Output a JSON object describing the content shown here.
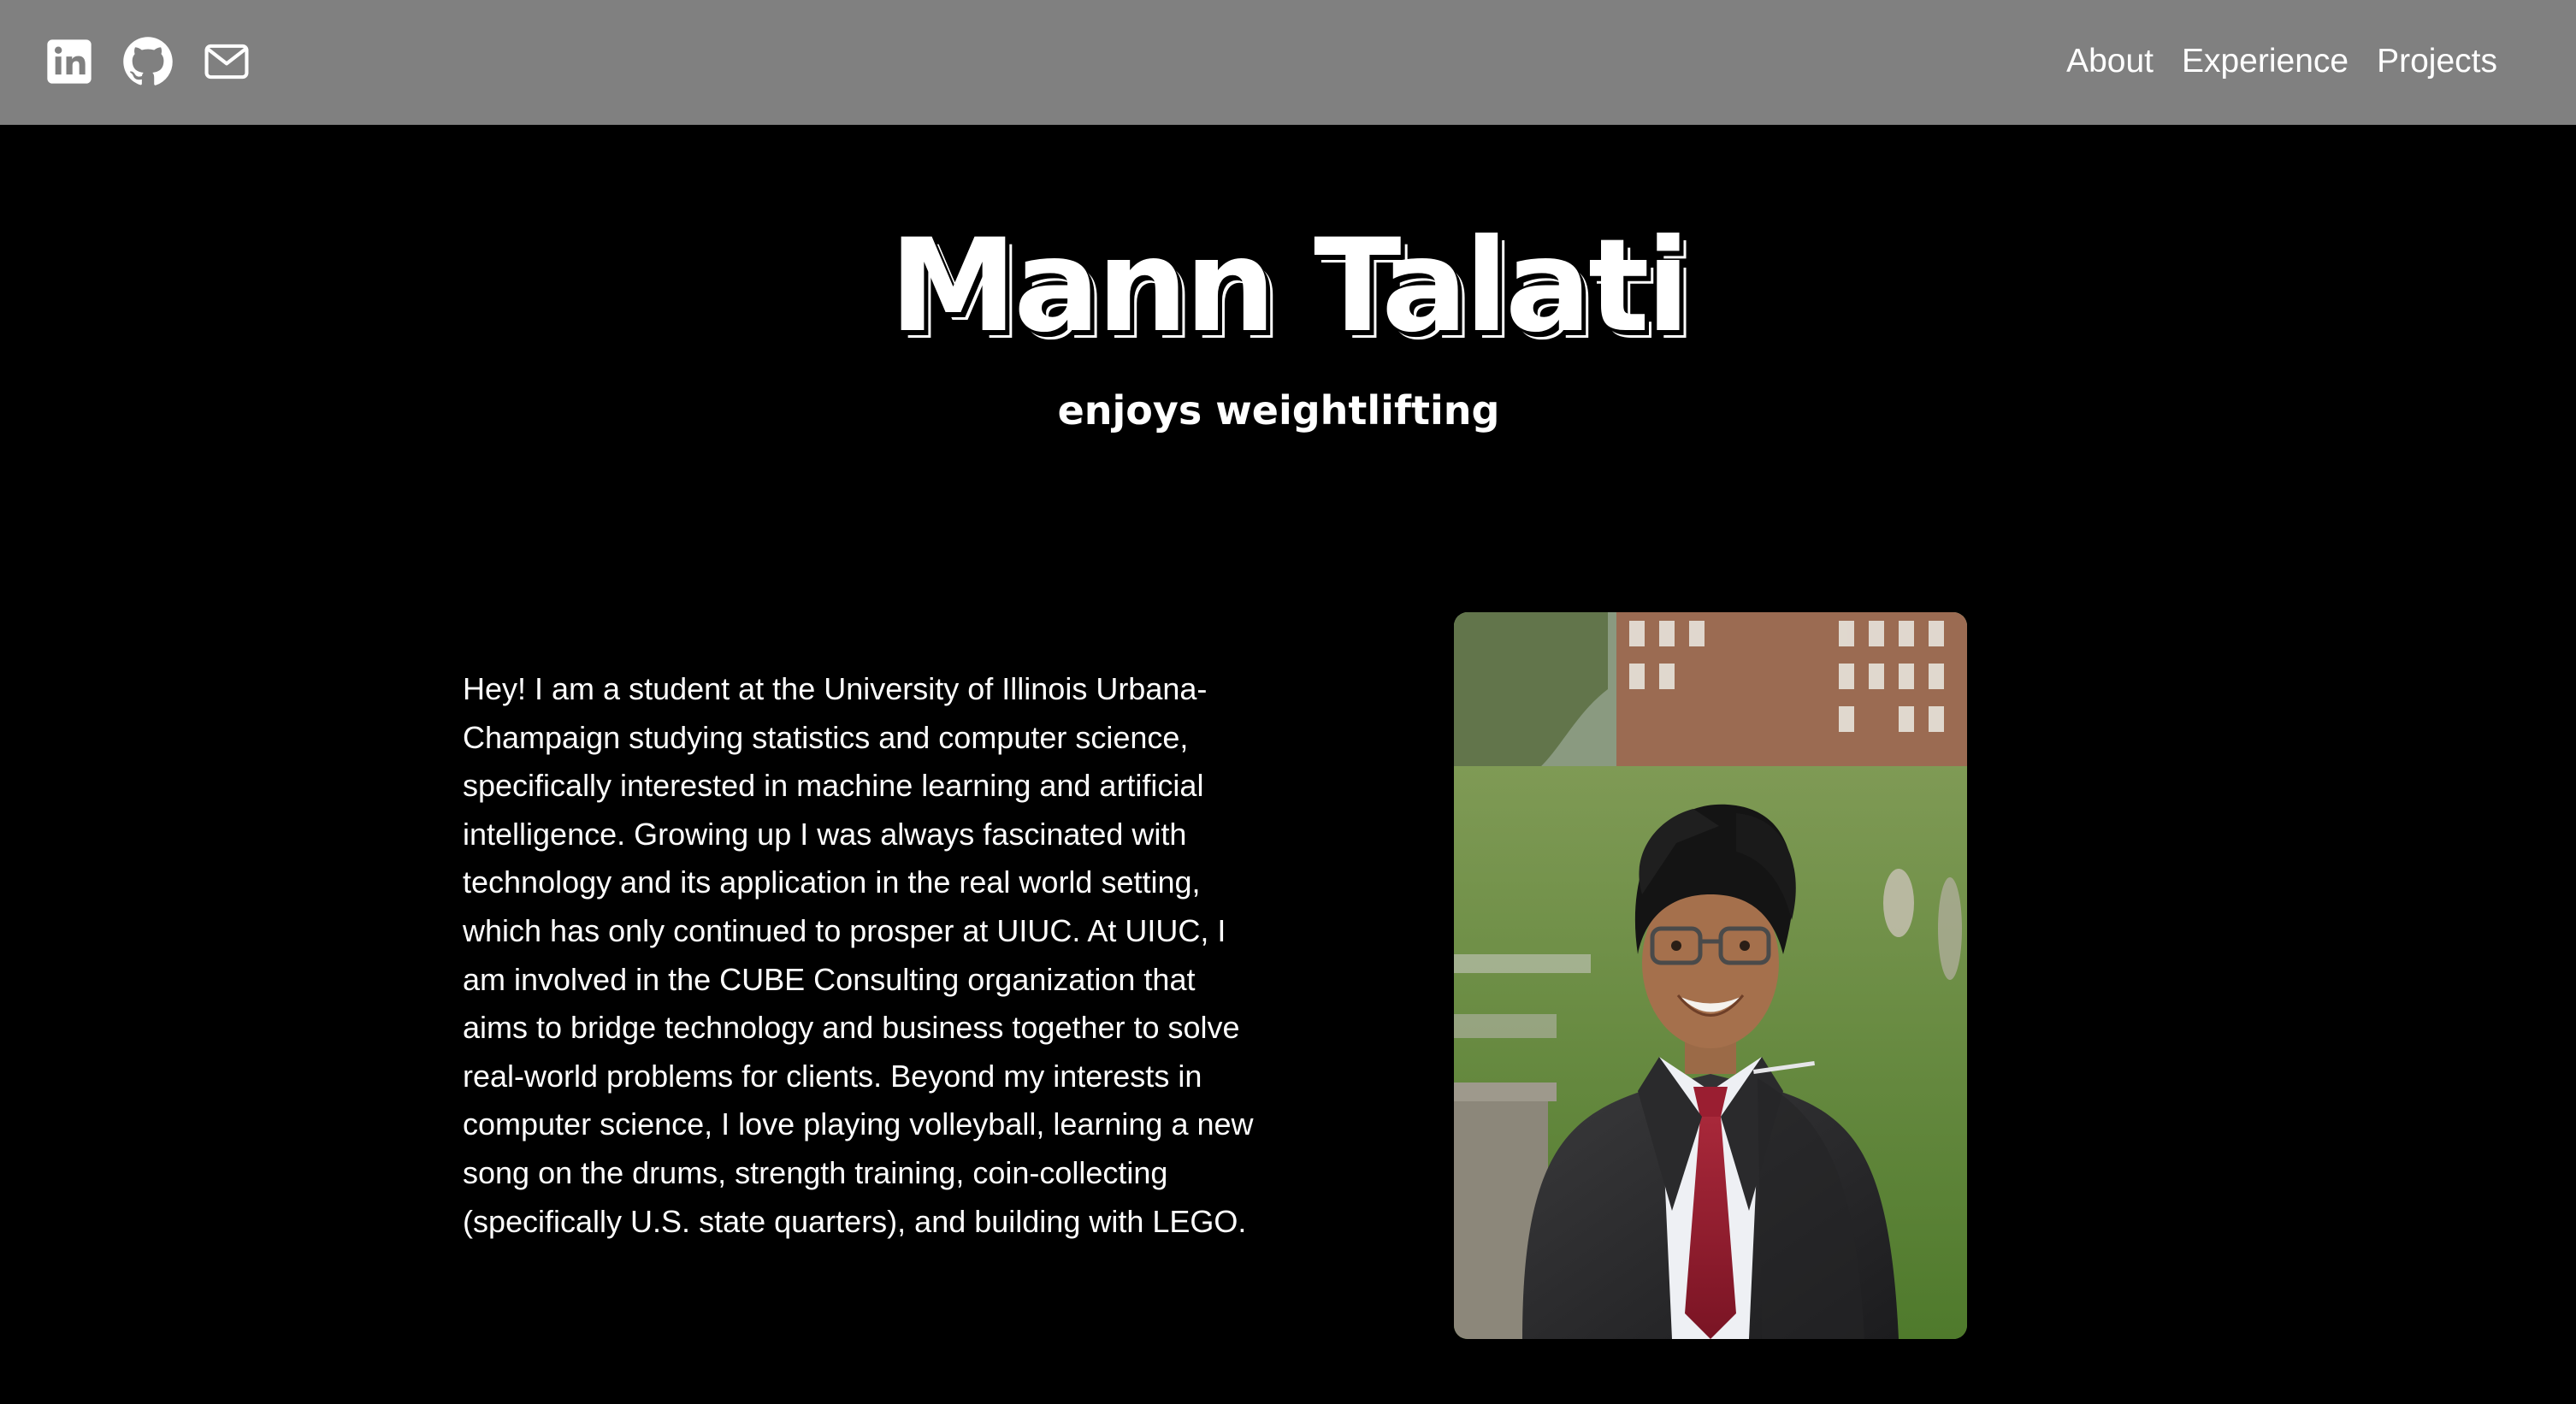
{
  "nav": {
    "icons": [
      "linkedin-icon",
      "github-icon",
      "mail-icon"
    ],
    "links": [
      "About",
      "Experience",
      "Projects"
    ]
  },
  "hero": {
    "name": "Mann Talati",
    "tagline": "enjoys weightlifting"
  },
  "about": {
    "text": "Hey! I am a student at the University of Illinois Urbana-Champaign studying statistics and computer science, specifically interested in machine learning and artificial intelligence. Growing up I was always fascinated with technology and its application in the real world setting, which has only continued to prosper at UIUC. At UIUC, I am involved in the CUBE Consulting organization that aims to bridge technology and business together to solve real-world problems for clients. Beyond my interests in computer science, I love playing volleyball, learning a new song on the drums, strength training, coin-collecting (specifically U.S. state quarters), and building with LEGO."
  },
  "colors": {
    "navbar": "#808080",
    "background": "#000000",
    "text": "#ffffff"
  }
}
